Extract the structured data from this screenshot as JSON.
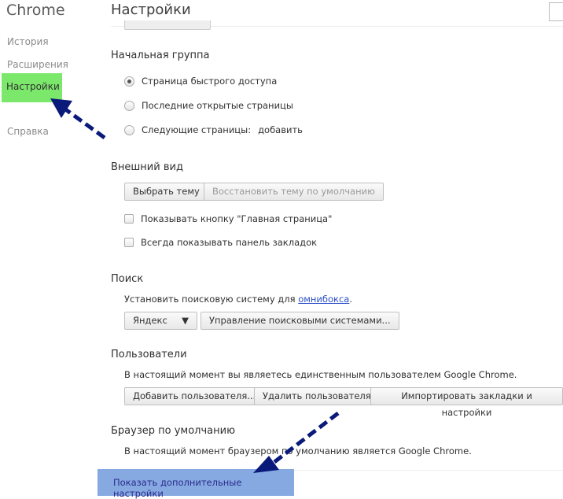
{
  "sidebar": {
    "title": "Chrome",
    "items": [
      {
        "label": "История"
      },
      {
        "label": "Расширения"
      },
      {
        "label": "Настройки",
        "active": true
      },
      {
        "label": "Справка"
      }
    ],
    "highlight_color": "#7be86b"
  },
  "header": {
    "title": "Настройки"
  },
  "startup": {
    "heading": "Начальная группа",
    "options": [
      {
        "label": "Страница быстрого доступа",
        "selected": true
      },
      {
        "label": "Последние открытые страницы",
        "selected": false
      },
      {
        "label": "Следующие страницы:",
        "selected": false
      }
    ],
    "add_link": "добавить"
  },
  "appearance": {
    "heading": "Внешний вид",
    "choose_theme": "Выбрать тему",
    "reset_theme": "Восстановить тему по умолчанию",
    "show_home": "Показывать кнопку \"Главная страница\"",
    "show_bookmarks": "Всегда показывать панель закладок"
  },
  "search": {
    "heading": "Поиск",
    "text_before": "Установить поисковую систему для ",
    "link": "омнибокса",
    "text_after": ".",
    "engine": "Яндекс",
    "manage": "Управление поисковыми системами..."
  },
  "users": {
    "heading": "Пользователи",
    "text": "В настоящий момент вы являетесь единственным пользователем Google Chrome.",
    "add": "Добавить пользователя...",
    "remove": "Удалить пользователя",
    "import": "Импортировать закладки и настройки"
  },
  "default_browser": {
    "heading": "Браузер по умолчанию",
    "text": "В настоящий момент браузером по умолчанию является Google Chrome."
  },
  "advanced": {
    "label": "Показать дополнительные настройки",
    "highlight_color": "#86a9e2"
  },
  "annotations": {
    "arrow_color": "#0a1a7a"
  }
}
